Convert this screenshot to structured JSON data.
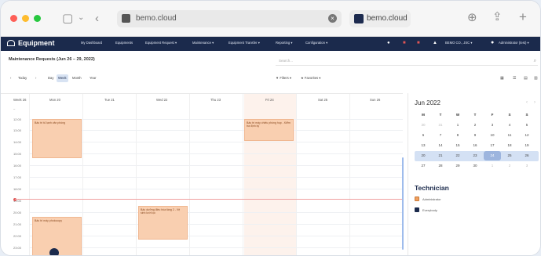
{
  "browser": {
    "url_text": "bemo.cloud",
    "tab_title": "bemo.cloud"
  },
  "app": {
    "logo_text": "Equipment",
    "nav": [
      "My Dashboard",
      "Equipments",
      "Equipment Request ▾",
      "Maintenance ▾",
      "Equipment Transfer ▾",
      "Reporting ▾",
      "Configuration ▾"
    ],
    "company": "BEMO CO., JSC ▾",
    "user": "Administrator (test) ▾"
  },
  "page": {
    "title": "Maintenance Requests (Jun 26 – 29, 2022)",
    "search_placeholder": "Search..."
  },
  "toolbar": {
    "today": "Today",
    "views": [
      "Day",
      "Week",
      "Month",
      "Year"
    ],
    "active_view": "Week",
    "filters": "Filters ▾",
    "favorites": "Favorites ▾"
  },
  "calendar": {
    "week_label": "Week 26",
    "days": [
      "Mon 20",
      "Tue 21",
      "Wed 22",
      "Thu 23",
      "Fri 24",
      "Sat 25",
      "Sun 26"
    ],
    "times": [
      "12:00",
      "13:00",
      "14:00",
      "15:00",
      "16:00",
      "17:00",
      "18:00",
      "19:00",
      "20:00",
      "21:00",
      "22:00",
      "23:00"
    ],
    "events": [
      {
        "title": "Bảo trì tủ lạnh văn phòng"
      },
      {
        "title": "Bảo trì máy chiếu phòng họp - Kiểm tra định kỳ"
      },
      {
        "title": "Bảo dưỡng điều hòa tầng 2 - Vệ sinh lưới lọc"
      },
      {
        "title": "Bảo trì máy photocopy"
      }
    ]
  },
  "minical": {
    "month": "Jun 2022",
    "weekday_heads": [
      "M",
      "T",
      "W",
      "T",
      "F",
      "S",
      "S"
    ],
    "weeks": [
      [
        "30",
        "31",
        "1",
        "2",
        "3",
        "4",
        "5"
      ],
      [
        "6",
        "7",
        "8",
        "9",
        "10",
        "11",
        "12"
      ],
      [
        "13",
        "14",
        "15",
        "16",
        "17",
        "18",
        "19"
      ],
      [
        "20",
        "21",
        "22",
        "23",
        "24",
        "25",
        "26"
      ],
      [
        "27",
        "28",
        "29",
        "30",
        "1",
        "2",
        "3"
      ]
    ]
  },
  "technician": {
    "title": "Technician",
    "items": [
      "Administrator",
      "Everybody"
    ]
  },
  "colors": {
    "nav_bg": "#1b2a4c",
    "event_bg": "#f9cfb0",
    "accent": "#9db5de"
  }
}
